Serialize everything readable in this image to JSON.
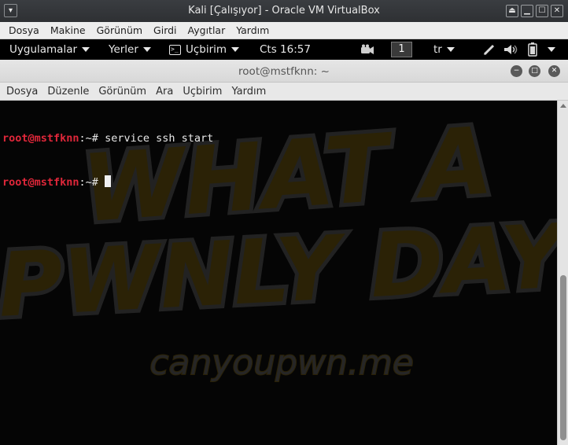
{
  "vbox": {
    "title": "Kali [Çalışıyor] - Oracle VM VirtualBox",
    "menu_icon": "chevron-down-icon",
    "window_buttons": [
      "⏏",
      "▁",
      "☐",
      "✕"
    ],
    "menu": [
      "Dosya",
      "Makine",
      "Görünüm",
      "Girdi",
      "Aygıtlar",
      "Yardım"
    ]
  },
  "panel": {
    "applications": "Uygulamalar",
    "places": "Yerler",
    "terminal_app": "Uçbirim",
    "clock": "Cts 16:57",
    "workspace": "1",
    "keyboard": "tr"
  },
  "terminal": {
    "title": "root@mstfknn: ~",
    "menu": [
      "Dosya",
      "Düzenle",
      "Görünüm",
      "Ara",
      "Uçbirim",
      "Yardım"
    ],
    "lines": [
      {
        "user": "root@mstfknn",
        "path": ":~#",
        "command": " service ssh start"
      },
      {
        "user": "root@mstfknn",
        "path": ":~#",
        "command": " "
      }
    ],
    "wallpaper": {
      "line1": "WHAT A",
      "line2": "PWNLY DAY",
      "site": "canyoupwn.me"
    }
  },
  "colors": {
    "prompt_user": "#e0273a",
    "wallpaper_text": "#2b2206",
    "wallpaper_outline": "#1c1c1c"
  }
}
